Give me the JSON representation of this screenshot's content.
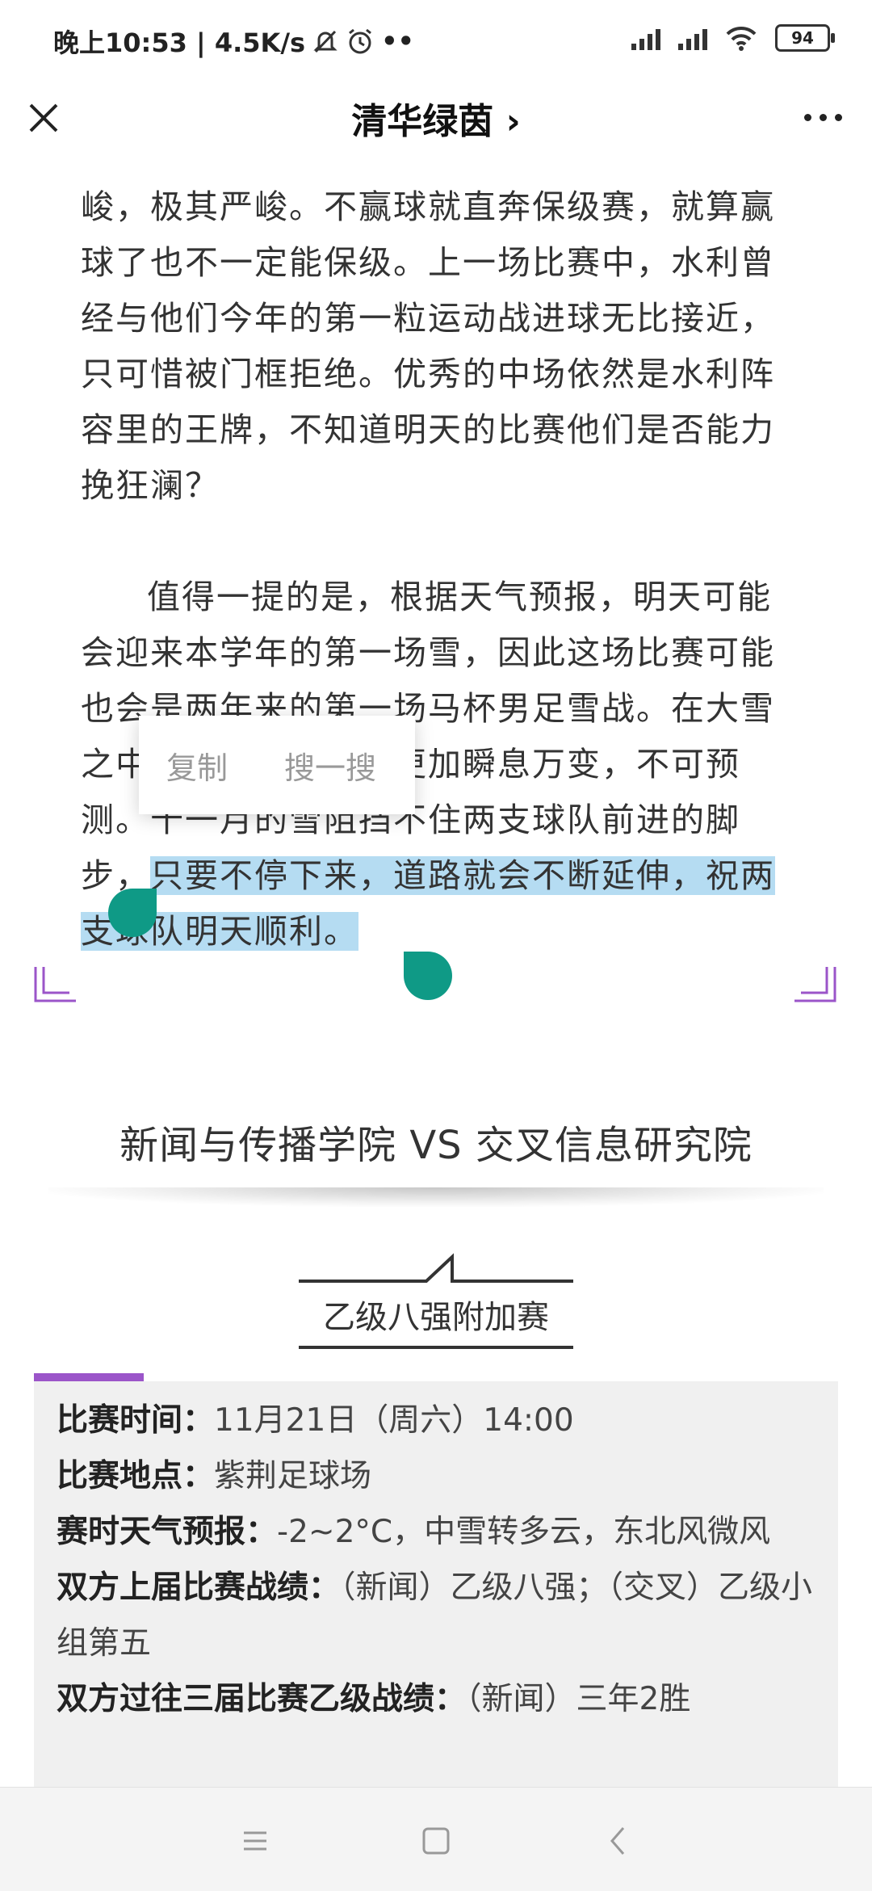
{
  "status_bar": {
    "time_speed": "晚上10:53 | 4.5K/s",
    "extra": "••",
    "battery": "94"
  },
  "nav": {
    "title": "清华绿茵 ›"
  },
  "article": {
    "p1": "峻，极其严峻。不赢球就直奔保级赛，就算赢球了也不一定能保级。上一场比赛中，水利曾经与他们今年的第一粒运动战进球无比接近，只可惜被门框拒绝。优秀的中场依然是水利阵容里的王牌，不知道明天的比赛他们是否能力挽狂澜？",
    "p2_plain": "值得一提的是，根据天气预报，明天可能会迎来本学年的第一场雪，因此这场比赛可能也会是两年来的第一场马杯男足雪战。在大雪之中比赛，局势将会更加瞬息万变，不可预测。十一月的雪阻挡不住两支球队前进的脚步，",
    "p2_selected": "只要不停下来，道路就会不断延伸，祝两支球队明天顺利。"
  },
  "context_menu": {
    "copy": "复制",
    "search": "搜一搜"
  },
  "match": {
    "title": "新闻与传播学院 VS 交叉信息研究院",
    "stage": "乙级八强附加赛"
  },
  "info": {
    "time_label": "比赛时间：",
    "time_value": "11月21日（周六）14:00",
    "venue_label": "比赛地点：",
    "venue_value": "紫荆足球场",
    "weather_label": "赛时天气预报：",
    "weather_value": "-2~2°C，中雪转多云，东北风微风",
    "last_label": "双方上届比赛战绩：",
    "last_value": "（新闻）乙级八强；（交叉）乙级小组第五",
    "history_label": "双方过往三届比赛乙级战绩：",
    "history_value": "（新闻）三年2胜"
  },
  "colors": {
    "accent_purple": "#9b55c9",
    "handle_teal": "#0f9a86",
    "selection_blue": "#b5dcf2"
  }
}
